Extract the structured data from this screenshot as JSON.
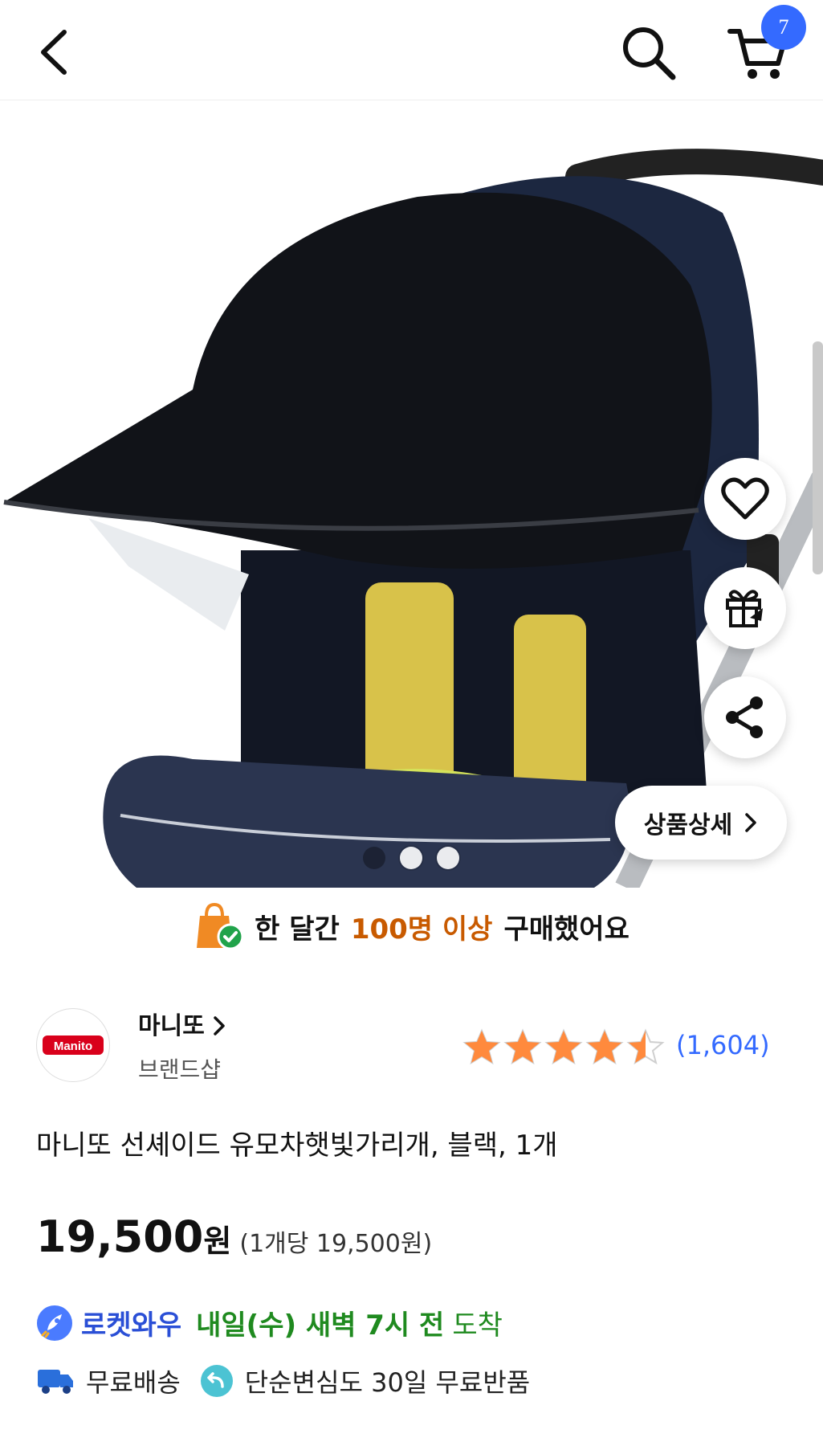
{
  "header": {
    "cart_count": "7",
    "colors": {
      "badge": "#346aff"
    }
  },
  "gallery": {
    "total_images": 3,
    "active_index": 0,
    "detail_button_label": "상품상세",
    "icons": [
      "heart-icon",
      "gift-rocket-icon",
      "share-icon",
      "chevron-right-icon"
    ]
  },
  "purchase_info": {
    "prefix": "한 달간",
    "highlight": "100명 이상",
    "suffix": "구매했어요",
    "colors": {
      "highlight": "#c85a00"
    }
  },
  "brand": {
    "logo_text": "Manito",
    "name": "마니또",
    "sub": "브랜드샵"
  },
  "rating": {
    "stars": 4.5,
    "count": "(1,604)",
    "colors": {
      "star": "#ff8a3d",
      "count": "#346aff"
    }
  },
  "product": {
    "title": "마니또 선셰이드 유모차햇빛가리개, 블랙, 1개"
  },
  "price": {
    "amount": "19,500",
    "currency": "원",
    "unit_price": "(1개당 19,500원)"
  },
  "delivery": {
    "rocket_label": "로켓와우",
    "date": "내일(수) 새벽 7시 전",
    "arrive": "도착",
    "free_shipping": "무료배송",
    "free_return": "단순변심도 30일 무료반품",
    "colors": {
      "rocket": "#2a4fd6",
      "date": "#1f8a1f"
    }
  }
}
